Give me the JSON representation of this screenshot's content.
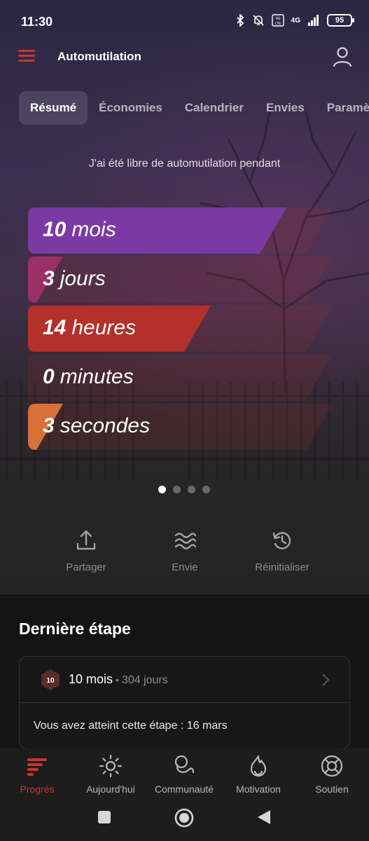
{
  "status": {
    "time": "11:30",
    "battery": "95",
    "net": "4G"
  },
  "app": {
    "title": "Automutilation"
  },
  "tabs": [
    {
      "label": "Résumé",
      "active": true
    },
    {
      "label": "Économies"
    },
    {
      "label": "Calendrier"
    },
    {
      "label": "Envies"
    },
    {
      "label": "Paramètr"
    }
  ],
  "summary": {
    "free_label": "J'ai été libre de automutilation pendant",
    "counters": [
      {
        "value": "10",
        "unit": "mois",
        "color": "#7b3aa3",
        "fill": 0.848
      },
      {
        "value": "3",
        "unit": "jours",
        "color": "#9b2f66",
        "fill": 0.1
      },
      {
        "value": "14",
        "unit": "heures",
        "color": "#b3302b",
        "fill": 0.6
      },
      {
        "value": "0",
        "unit": "minutes",
        "color": "#c4572e",
        "fill": 0.0
      },
      {
        "value": "3",
        "unit": "secondes",
        "color": "#d9703a",
        "fill": 0.05
      }
    ],
    "page_dots": 4,
    "active_dot": 0
  },
  "actions": [
    {
      "label": "Partager",
      "icon": "share-icon"
    },
    {
      "label": "Envie",
      "icon": "waves-icon"
    },
    {
      "label": "Réinitialiser",
      "icon": "history-icon"
    }
  ],
  "milestone": {
    "section_title": "Dernière étape",
    "badge": "10",
    "name": "10 mois",
    "separator": "•",
    "days": "304 jours",
    "reached": "Vous avez atteint cette étape : 16 mars"
  },
  "nav": [
    {
      "label": "Progrès",
      "icon": "progress-icon",
      "active": true
    },
    {
      "label": "Aujourd'hui",
      "icon": "sun-icon"
    },
    {
      "label": "Communauté",
      "icon": "community-icon"
    },
    {
      "label": "Motivation",
      "icon": "flame-icon"
    },
    {
      "label": "Soutien",
      "icon": "lifebuoy-icon"
    }
  ],
  "colors": {
    "accent": "#c9362e",
    "background": "#141414"
  }
}
